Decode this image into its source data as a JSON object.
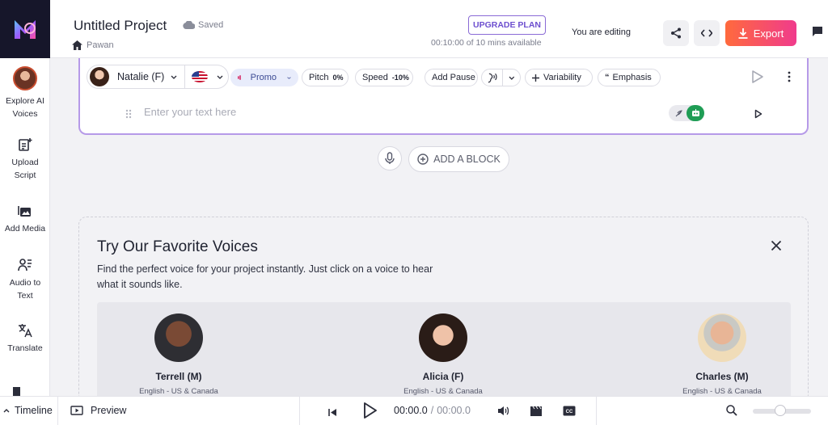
{
  "app": {
    "project_title": "Untitled Project",
    "save_status": "Saved",
    "owner": "Pawan",
    "upgrade_label": "UPGRADE PLAN",
    "minutes_available": "00:10:00 of 10 mins available",
    "editing_status": "You are editing",
    "export_label": "Export"
  },
  "sidebar": {
    "items": [
      {
        "label_line1": "Explore AI",
        "label_line2": "Voices",
        "icon": "voice-avatar-icon"
      },
      {
        "label_line1": "Upload",
        "label_line2": "Script",
        "icon": "upload-script-icon"
      },
      {
        "label_line1": "Add Media",
        "label_line2": "",
        "icon": "add-media-icon"
      },
      {
        "label_line1": "Audio to",
        "label_line2": "Text",
        "icon": "audio-to-text-icon"
      },
      {
        "label_line1": "Translate",
        "label_line2": "",
        "icon": "translate-icon"
      }
    ]
  },
  "block": {
    "voice_name": "Natalie (F)",
    "style": "Promo",
    "pitch_label": "Pitch",
    "pitch_value": "0%",
    "speed_label": "Speed",
    "speed_value": "-10%",
    "add_pause_label": "Add Pause",
    "variability_label": "Variability",
    "emphasis_label": "Emphasis",
    "text_placeholder": "Enter your text here"
  },
  "add_block_label": "ADD A BLOCK",
  "favorites": {
    "title": "Try Our Favorite Voices",
    "description": "Find the perfect voice for your project instantly. Just click on a voice to hear what it sounds like.",
    "voices": [
      {
        "name": "Terrell (M)",
        "accent": "English - US & Canada"
      },
      {
        "name": "Alicia (F)",
        "accent": "English - US & Canada"
      },
      {
        "name": "Charles (M)",
        "accent": "English - US & Canada"
      }
    ]
  },
  "footer": {
    "timeline_label": "Timeline",
    "preview_label": "Preview",
    "current_time": "00:00.0",
    "total_time": "00:00.0",
    "time_separator": "/"
  },
  "colors": {
    "accent": "#6d4fcf",
    "block_border": "#b69ae8",
    "export_gradient_start": "#ff6a3d",
    "export_gradient_end": "#f03b8c",
    "promo_chip": "#e8ecfb"
  }
}
